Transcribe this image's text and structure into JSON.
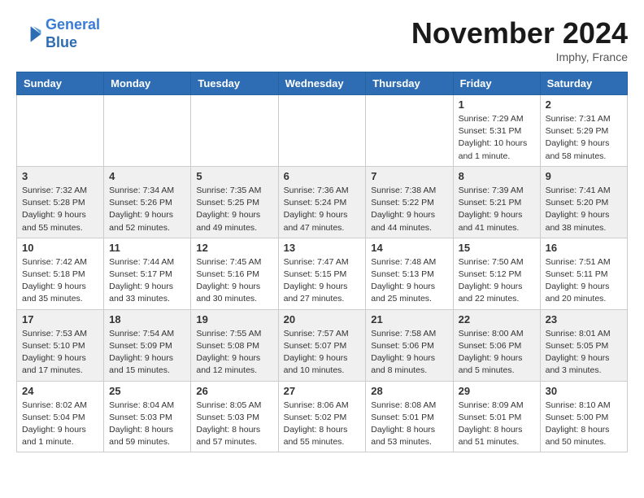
{
  "header": {
    "logo_line1": "General",
    "logo_line2": "Blue",
    "month": "November 2024",
    "location": "Imphy, France"
  },
  "days_of_week": [
    "Sunday",
    "Monday",
    "Tuesday",
    "Wednesday",
    "Thursday",
    "Friday",
    "Saturday"
  ],
  "weeks": [
    [
      {
        "day": "",
        "info": ""
      },
      {
        "day": "",
        "info": ""
      },
      {
        "day": "",
        "info": ""
      },
      {
        "day": "",
        "info": ""
      },
      {
        "day": "",
        "info": ""
      },
      {
        "day": "1",
        "info": "Sunrise: 7:29 AM\nSunset: 5:31 PM\nDaylight: 10 hours and 1 minute."
      },
      {
        "day": "2",
        "info": "Sunrise: 7:31 AM\nSunset: 5:29 PM\nDaylight: 9 hours and 58 minutes."
      }
    ],
    [
      {
        "day": "3",
        "info": "Sunrise: 7:32 AM\nSunset: 5:28 PM\nDaylight: 9 hours and 55 minutes."
      },
      {
        "day": "4",
        "info": "Sunrise: 7:34 AM\nSunset: 5:26 PM\nDaylight: 9 hours and 52 minutes."
      },
      {
        "day": "5",
        "info": "Sunrise: 7:35 AM\nSunset: 5:25 PM\nDaylight: 9 hours and 49 minutes."
      },
      {
        "day": "6",
        "info": "Sunrise: 7:36 AM\nSunset: 5:24 PM\nDaylight: 9 hours and 47 minutes."
      },
      {
        "day": "7",
        "info": "Sunrise: 7:38 AM\nSunset: 5:22 PM\nDaylight: 9 hours and 44 minutes."
      },
      {
        "day": "8",
        "info": "Sunrise: 7:39 AM\nSunset: 5:21 PM\nDaylight: 9 hours and 41 minutes."
      },
      {
        "day": "9",
        "info": "Sunrise: 7:41 AM\nSunset: 5:20 PM\nDaylight: 9 hours and 38 minutes."
      }
    ],
    [
      {
        "day": "10",
        "info": "Sunrise: 7:42 AM\nSunset: 5:18 PM\nDaylight: 9 hours and 35 minutes."
      },
      {
        "day": "11",
        "info": "Sunrise: 7:44 AM\nSunset: 5:17 PM\nDaylight: 9 hours and 33 minutes."
      },
      {
        "day": "12",
        "info": "Sunrise: 7:45 AM\nSunset: 5:16 PM\nDaylight: 9 hours and 30 minutes."
      },
      {
        "day": "13",
        "info": "Sunrise: 7:47 AM\nSunset: 5:15 PM\nDaylight: 9 hours and 27 minutes."
      },
      {
        "day": "14",
        "info": "Sunrise: 7:48 AM\nSunset: 5:13 PM\nDaylight: 9 hours and 25 minutes."
      },
      {
        "day": "15",
        "info": "Sunrise: 7:50 AM\nSunset: 5:12 PM\nDaylight: 9 hours and 22 minutes."
      },
      {
        "day": "16",
        "info": "Sunrise: 7:51 AM\nSunset: 5:11 PM\nDaylight: 9 hours and 20 minutes."
      }
    ],
    [
      {
        "day": "17",
        "info": "Sunrise: 7:53 AM\nSunset: 5:10 PM\nDaylight: 9 hours and 17 minutes."
      },
      {
        "day": "18",
        "info": "Sunrise: 7:54 AM\nSunset: 5:09 PM\nDaylight: 9 hours and 15 minutes."
      },
      {
        "day": "19",
        "info": "Sunrise: 7:55 AM\nSunset: 5:08 PM\nDaylight: 9 hours and 12 minutes."
      },
      {
        "day": "20",
        "info": "Sunrise: 7:57 AM\nSunset: 5:07 PM\nDaylight: 9 hours and 10 minutes."
      },
      {
        "day": "21",
        "info": "Sunrise: 7:58 AM\nSunset: 5:06 PM\nDaylight: 9 hours and 8 minutes."
      },
      {
        "day": "22",
        "info": "Sunrise: 8:00 AM\nSunset: 5:06 PM\nDaylight: 9 hours and 5 minutes."
      },
      {
        "day": "23",
        "info": "Sunrise: 8:01 AM\nSunset: 5:05 PM\nDaylight: 9 hours and 3 minutes."
      }
    ],
    [
      {
        "day": "24",
        "info": "Sunrise: 8:02 AM\nSunset: 5:04 PM\nDaylight: 9 hours and 1 minute."
      },
      {
        "day": "25",
        "info": "Sunrise: 8:04 AM\nSunset: 5:03 PM\nDaylight: 8 hours and 59 minutes."
      },
      {
        "day": "26",
        "info": "Sunrise: 8:05 AM\nSunset: 5:03 PM\nDaylight: 8 hours and 57 minutes."
      },
      {
        "day": "27",
        "info": "Sunrise: 8:06 AM\nSunset: 5:02 PM\nDaylight: 8 hours and 55 minutes."
      },
      {
        "day": "28",
        "info": "Sunrise: 8:08 AM\nSunset: 5:01 PM\nDaylight: 8 hours and 53 minutes."
      },
      {
        "day": "29",
        "info": "Sunrise: 8:09 AM\nSunset: 5:01 PM\nDaylight: 8 hours and 51 minutes."
      },
      {
        "day": "30",
        "info": "Sunrise: 8:10 AM\nSunset: 5:00 PM\nDaylight: 8 hours and 50 minutes."
      }
    ]
  ]
}
